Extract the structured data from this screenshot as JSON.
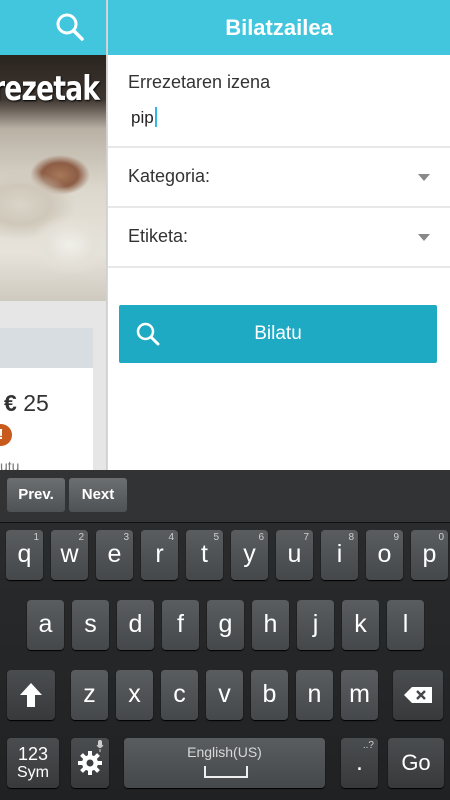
{
  "background": {
    "image_title": "rezetak",
    "price_currency": "€",
    "price_value": "25",
    "badge": "!",
    "card_text": "utu"
  },
  "search": {
    "title": "Bilatzailea",
    "name_label": "Errezetaren izena",
    "name_value": "pip",
    "category_label": "Kategoria:",
    "tag_label": "Etiketa:",
    "button_label": "Bilatu"
  },
  "keyboard": {
    "prev": "Prev.",
    "next": "Next",
    "row1": [
      {
        "k": "q",
        "h": "1"
      },
      {
        "k": "w",
        "h": "2"
      },
      {
        "k": "e",
        "h": "3"
      },
      {
        "k": "r",
        "h": "4"
      },
      {
        "k": "t",
        "h": "5"
      },
      {
        "k": "y",
        "h": "6"
      },
      {
        "k": "u",
        "h": "7"
      },
      {
        "k": "i",
        "h": "8"
      },
      {
        "k": "o",
        "h": "9"
      },
      {
        "k": "p",
        "h": "0"
      }
    ],
    "row2": [
      "a",
      "s",
      "d",
      "f",
      "g",
      "h",
      "j",
      "k",
      "l"
    ],
    "row3": [
      "z",
      "x",
      "c",
      "v",
      "b",
      "n",
      "m"
    ],
    "sym_line1": "123",
    "sym_line2": "Sym",
    "space_lang": "English(US)",
    "period": ".",
    "period_hint": "..?",
    "go": "Go"
  },
  "colors": {
    "accent": "#41c6de",
    "button": "#1eaac3",
    "caret": "#33b5e5"
  }
}
